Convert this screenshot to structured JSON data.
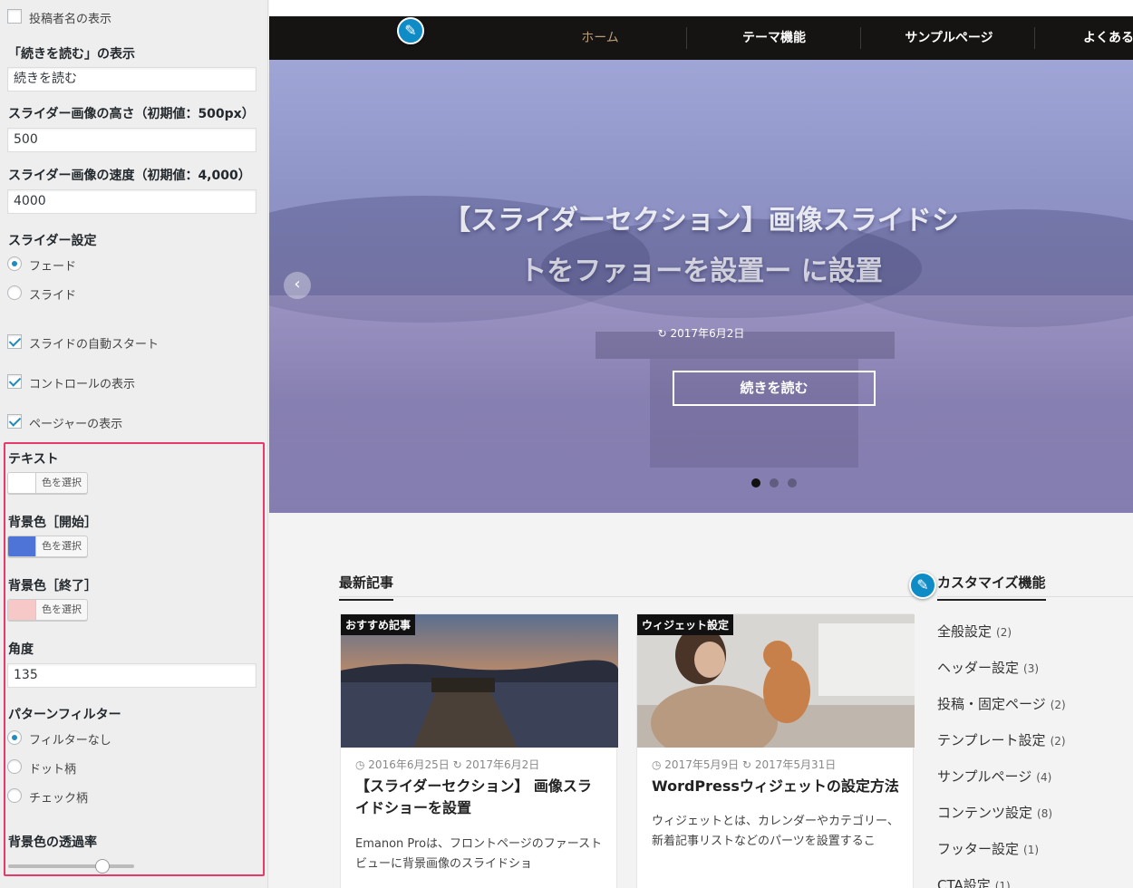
{
  "panel": {
    "show_author": {
      "label": "投稿者名の表示",
      "checked": false
    },
    "readmore_label": "「続きを読む」の表示",
    "readmore_value": "続きを読む",
    "slider_height_label": "スライダー画像の高さ（初期値：500px）",
    "slider_height_value": "500",
    "slider_speed_label": "スライダー画像の速度（初期値：4,000）",
    "slider_speed_value": "4000",
    "slider_setting_label": "スライダー設定",
    "slider_modes": [
      {
        "label": "フェード",
        "selected": true
      },
      {
        "label": "スライド",
        "selected": false
      }
    ],
    "autostart": {
      "label": "スライドの自動スタート",
      "checked": true
    },
    "controls": {
      "label": "コントロールの表示",
      "checked": true
    },
    "pager": {
      "label": "ページャーの表示",
      "checked": true
    },
    "text_color_label": "テキスト",
    "text_color": "#ffffff",
    "bg_start_label": "背景色［開始］",
    "bg_start_color": "#4f74d7",
    "bg_end_label": "背景色［終了］",
    "bg_end_color": "#f7c8c8",
    "color_button": "色を選択",
    "angle_label": "角度",
    "angle_value": "135",
    "pattern_label": "パターンフィルター",
    "pattern_options": [
      {
        "label": "フィルターなし",
        "selected": true
      },
      {
        "label": "ドット柄",
        "selected": false
      },
      {
        "label": "チェック柄",
        "selected": false
      }
    ],
    "opacity_label": "背景色の透過率",
    "opacity_value": 0.75,
    "highlight_color": "#e8396b"
  },
  "preview": {
    "nav": [
      "ホーム",
      "テーマ機能",
      "サンプルページ",
      "よくある"
    ],
    "nav_active_color": "#b89d7a",
    "hero": {
      "title_line1": "【スライダーセクション】画像スライドシ",
      "title_line2": "トをファョーを設置ー に設置",
      "date": "2017年6月2日",
      "button": "続きを読む",
      "prev_icon": "chevron-left-icon"
    },
    "latest_heading": "最新記事",
    "cards": [
      {
        "badge": "おすすめ記事",
        "published": "2016年6月25日",
        "updated": "2017年6月2日",
        "title": "【スライダーセクション】 画像スライドショーを設置",
        "excerpt": "Emanon Proは、フロントページのファーストビューに背景画像のスライドショ"
      },
      {
        "badge": "ウィジェット設定",
        "published": "2017年5月9日",
        "updated": "2017年5月31日",
        "title": "WordPressウィジェットの設定方法",
        "excerpt": "ウィジェットとは、カレンダーやカテゴリー、新着記事リストなどのパーツを設置するこ"
      }
    ],
    "side_heading": "カスタマイズ機能",
    "side_items": [
      {
        "label": "全般設定",
        "count": "(2)"
      },
      {
        "label": "ヘッダー設定",
        "count": "(3)"
      },
      {
        "label": "投稿・固定ページ",
        "count": "(2)"
      },
      {
        "label": "テンプレート設定",
        "count": "(2)"
      },
      {
        "label": "サンプルページ",
        "count": "(4)"
      },
      {
        "label": "コンテンツ設定",
        "count": "(8)"
      },
      {
        "label": "フッター設定",
        "count": "(1)"
      },
      {
        "label": "CTA設定",
        "count": "(1)"
      }
    ]
  }
}
